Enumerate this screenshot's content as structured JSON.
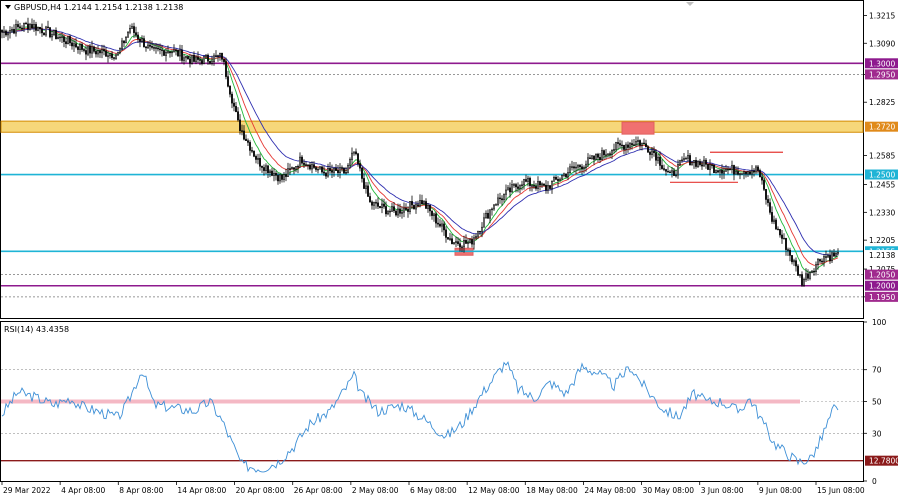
{
  "header": {
    "symbol_line": "GBPUSD,H4  1.2144 1.2154 1.2138 1.2138"
  },
  "rsi_header": {
    "label": "RSI(14) 43.4358"
  },
  "colors": {
    "bull": "#000000",
    "bear": "#000000",
    "ma_fast": "#22b83a",
    "ma_mid": "#e53935",
    "ma_slow": "#2f2fb0",
    "level_purple": "#8e1a8e",
    "level_cyan": "#1fb4d6",
    "zone_fill": "#f6d77a",
    "zone_border": "#d48a00",
    "marker": "#f07070",
    "rsi_line": "#3d8fd6",
    "rsi_band": "#f4b8c4",
    "rsi_bottom": "#8b1a1a"
  },
  "chart_data": {
    "type": "candlestick",
    "symbol": "GBPUSD",
    "timeframe": "H4",
    "price_axis": {
      "ylim": [
        1.1855,
        1.328
      ],
      "ticks": [
        "1.3215",
        "1.3090",
        "1.2950",
        "1.2825",
        "1.2585",
        "1.2455",
        "1.2330",
        "1.2205",
        "1.2075",
        "1.1950"
      ]
    },
    "time_axis": {
      "tick_labels": [
        "29 Mar 2022",
        "4 Apr 08:00",
        "8 Apr 08:00",
        "14 Apr 08:00",
        "20 Apr 08:00",
        "26 Apr 08:00",
        "2 May 08:00",
        "6 May 08:00",
        "12 May 08:00",
        "18 May 08:00",
        "24 May 08:00",
        "30 May 08:00",
        "3 Jun 08:00",
        "9 Jun 08:00",
        "15 Jun 08:00"
      ]
    },
    "levels": [
      {
        "price": 1.3,
        "label": "1.3000",
        "style": "solid",
        "color": "purple"
      },
      {
        "price": 1.295,
        "label": "1.2950",
        "style": "dotted",
        "color": "purple"
      },
      {
        "price": 1.25,
        "label": "1.2500",
        "style": "solid",
        "color": "cyan"
      },
      {
        "price": 1.2155,
        "label": "1.2155",
        "style": "solid",
        "color": "cyan"
      },
      {
        "price": 1.205,
        "label": "1.2050",
        "style": "dotted",
        "color": "purple"
      },
      {
        "price": 1.2,
        "label": "1.2000",
        "style": "solid",
        "color": "purple"
      },
      {
        "price": 1.195,
        "label": "1.1950",
        "style": "dotted",
        "color": "purple"
      }
    ],
    "zone": {
      "from": 1.269,
      "to": 1.274,
      "label": "1.2720"
    },
    "current_price": "1.2138",
    "path_keypoints": [
      [
        0,
        1.314
      ],
      [
        14,
        1.3175
      ],
      [
        28,
        1.312
      ],
      [
        42,
        1.306
      ],
      [
        58,
        1.304
      ],
      [
        64,
        1.316
      ],
      [
        75,
        1.305
      ],
      [
        84,
        1.306
      ],
      [
        96,
        1.301
      ],
      [
        110,
        1.303
      ],
      [
        118,
        1.273
      ],
      [
        128,
        1.256
      ],
      [
        140,
        1.248
      ],
      [
        150,
        1.257
      ],
      [
        160,
        1.251
      ],
      [
        172,
        1.251
      ],
      [
        176,
        1.26
      ],
      [
        184,
        1.237
      ],
      [
        196,
        1.233
      ],
      [
        210,
        1.238
      ],
      [
        225,
        1.22
      ],
      [
        234,
        1.219
      ],
      [
        246,
        1.237
      ],
      [
        260,
        1.247
      ],
      [
        272,
        1.244
      ],
      [
        284,
        1.252
      ],
      [
        294,
        1.256
      ],
      [
        306,
        1.262
      ],
      [
        318,
        1.265
      ],
      [
        326,
        1.26
      ],
      [
        334,
        1.249
      ],
      [
        342,
        1.257
      ],
      [
        356,
        1.253
      ],
      [
        366,
        1.252
      ],
      [
        378,
        1.252
      ],
      [
        385,
        1.23
      ],
      [
        392,
        1.218
      ],
      [
        400,
        1.202
      ],
      [
        410,
        1.213
      ],
      [
        418,
        1.2138
      ]
    ],
    "rsi": {
      "label": "RSI(14) 43.4358",
      "value": 43.4358,
      "ylim": [
        0,
        100
      ],
      "tick_labels": [
        "100",
        "70",
        "50",
        "30",
        "0"
      ],
      "levels": [
        70,
        50,
        30
      ],
      "bottom_label": "12.7800",
      "keypoints": [
        [
          0,
          42
        ],
        [
          8,
          56
        ],
        [
          16,
          53
        ],
        [
          26,
          48
        ],
        [
          34,
          52
        ],
        [
          40,
          47
        ],
        [
          50,
          43
        ],
        [
          58,
          40
        ],
        [
          62,
          47
        ],
        [
          70,
          70
        ],
        [
          76,
          48
        ],
        [
          86,
          46
        ],
        [
          96,
          44
        ],
        [
          104,
          50
        ],
        [
          110,
          38
        ],
        [
          120,
          10
        ],
        [
          130,
          8
        ],
        [
          138,
          12
        ],
        [
          146,
          22
        ],
        [
          154,
          36
        ],
        [
          164,
          44
        ],
        [
          176,
          66
        ],
        [
          180,
          54
        ],
        [
          188,
          44
        ],
        [
          200,
          48
        ],
        [
          210,
          40
        ],
        [
          222,
          28
        ],
        [
          230,
          36
        ],
        [
          240,
          55
        ],
        [
          252,
          75
        ],
        [
          258,
          58
        ],
        [
          266,
          52
        ],
        [
          274,
          62
        ],
        [
          282,
          55
        ],
        [
          290,
          72
        ],
        [
          298,
          68
        ],
        [
          306,
          60
        ],
        [
          314,
          72
        ],
        [
          322,
          58
        ],
        [
          330,
          46
        ],
        [
          338,
          40
        ],
        [
          346,
          55
        ],
        [
          352,
          50
        ],
        [
          360,
          50
        ],
        [
          368,
          44
        ],
        [
          374,
          52
        ],
        [
          380,
          38
        ],
        [
          386,
          24
        ],
        [
          392,
          18
        ],
        [
          398,
          12
        ],
        [
          404,
          14
        ],
        [
          408,
          22
        ],
        [
          412,
          34
        ],
        [
          416,
          46
        ],
        [
          418,
          43
        ]
      ]
    }
  }
}
